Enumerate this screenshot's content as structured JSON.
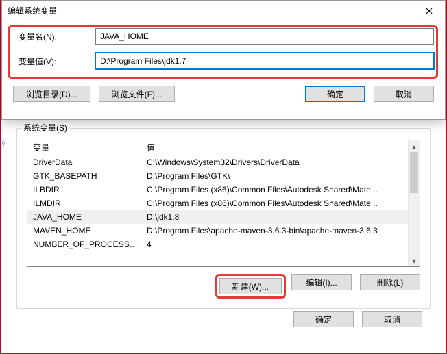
{
  "dialog": {
    "title": "编辑系统变量",
    "name_label": "变量名(N):",
    "name_value": "JAVA_HOME",
    "value_label": "变量值(V):",
    "value_value": "D:\\Program Files\\jdk1.7",
    "browse_dir": "浏览目录(D)...",
    "browse_file": "浏览文件(F)...",
    "ok": "确定",
    "cancel": "取消"
  },
  "sys": {
    "group": "系统变量(S)",
    "col_var": "变量",
    "col_val": "值",
    "rows": [
      {
        "var": "DriverData",
        "val": "C:\\Windows\\System32\\Drivers\\DriverData"
      },
      {
        "var": "GTK_BASEPATH",
        "val": "D:\\Program Files\\GTK\\"
      },
      {
        "var": "ILBDIR",
        "val": "C:\\Program Files (x86)\\Common Files\\Autodesk Shared\\Mate..."
      },
      {
        "var": "ILMDIR",
        "val": "C:\\Program Files (x86)\\Common Files\\Autodesk Shared\\Mate..."
      },
      {
        "var": "JAVA_HOME",
        "val": "D:\\jdk1.8"
      },
      {
        "var": "MAVEN_HOME",
        "val": "D:\\Program Files\\apache-maven-3.6.3-bin\\apache-maven-3.6.3"
      },
      {
        "var": "NUMBER_OF_PROCESSORS",
        "val": "4"
      }
    ],
    "new": "新建(W)...",
    "edit": "编辑(I)...",
    "delete": "删除(L)",
    "ok": "确定",
    "cancel": "取消"
  },
  "side_label": "ŷ"
}
